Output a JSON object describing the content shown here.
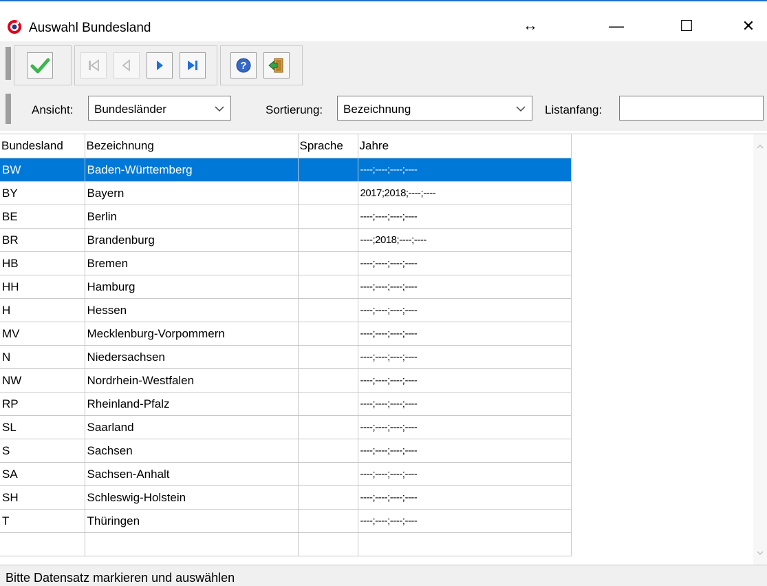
{
  "window": {
    "title": "Auswahl Bundesland",
    "resize_glyph": "↔",
    "minimize_glyph": "—",
    "maximize_glyph": "☐",
    "close_glyph": "✕"
  },
  "toolbar": {
    "buttons": [
      {
        "name": "confirm-button",
        "icon": "checkmark-icon"
      },
      {
        "name": "first-record-button",
        "icon": "first-record-icon"
      },
      {
        "name": "previous-record-button",
        "icon": "previous-record-icon"
      },
      {
        "name": "next-record-button",
        "icon": "next-record-icon"
      },
      {
        "name": "last-record-button",
        "icon": "last-record-icon"
      },
      {
        "name": "help-button",
        "icon": "help-icon"
      },
      {
        "name": "exit-button",
        "icon": "exit-door-icon"
      }
    ]
  },
  "filter": {
    "ansicht_label": "Ansicht:",
    "ansicht_value": "Bundesländer",
    "sortierung_label": "Sortierung:",
    "sortierung_value": "Bezeichnung",
    "listanfang_label": "Listanfang:",
    "listanfang_value": ""
  },
  "table": {
    "columns": [
      "Bundesland",
      "Bezeichnung",
      "Sprache",
      "Jahre"
    ],
    "selected_index": 0,
    "rows": [
      [
        "BW",
        "Baden-Württemberg",
        "",
        "----;----;----;----"
      ],
      [
        "BY",
        "Bayern",
        "",
        "2017;2018;----;----"
      ],
      [
        "BE",
        "Berlin",
        "",
        "----;----;----;----"
      ],
      [
        "BR",
        "Brandenburg",
        "",
        "----;2018;----;----"
      ],
      [
        "HB",
        "Bremen",
        "",
        "----;----;----;----"
      ],
      [
        "HH",
        "Hamburg",
        "",
        "----;----;----;----"
      ],
      [
        "H",
        "Hessen",
        "",
        "----;----;----;----"
      ],
      [
        "MV",
        "Mecklenburg-Vorpommern",
        "",
        "----;----;----;----"
      ],
      [
        "N",
        "Niedersachsen",
        "",
        "----;----;----;----"
      ],
      [
        "NW",
        "Nordrhein-Westfalen",
        "",
        "----;----;----;----"
      ],
      [
        "RP",
        "Rheinland-Pfalz",
        "",
        "----;----;----;----"
      ],
      [
        "SL",
        "Saarland",
        "",
        "----;----;----;----"
      ],
      [
        "S",
        "Sachsen",
        "",
        "----;----;----;----"
      ],
      [
        "SA",
        "Sachsen-Anhalt",
        "",
        "----;----;----;----"
      ],
      [
        "SH",
        "Schleswig-Holstein",
        "",
        "----;----;----;----"
      ],
      [
        "T",
        "Thüringen",
        "",
        "----;----;----;----"
      ],
      [
        "",
        "",
        "",
        ""
      ]
    ]
  },
  "status": {
    "text": "Bitte Datensatz markieren und auswählen"
  },
  "colors": {
    "selection": "#0078d7",
    "toolbar_bg": "#f0f0f0",
    "title_accent": "#1f6fd1"
  }
}
